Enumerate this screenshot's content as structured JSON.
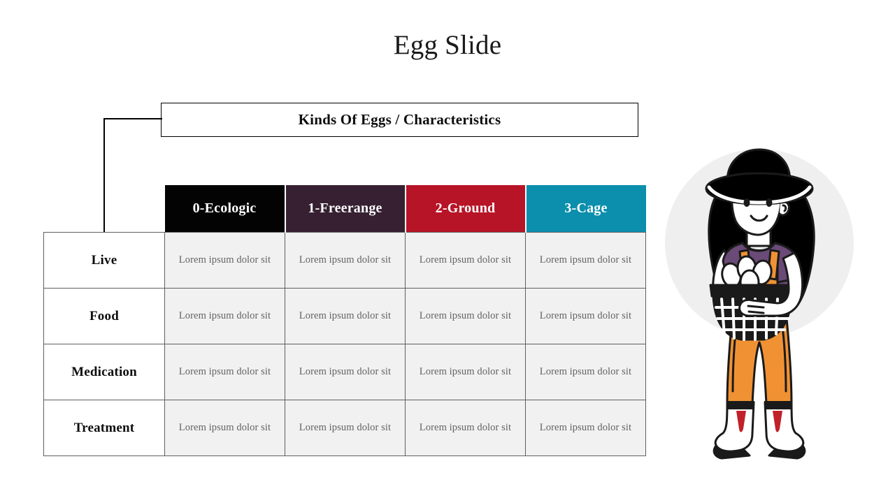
{
  "slide": {
    "title": "Egg Slide",
    "background_color": "#ffffff"
  },
  "banner": {
    "text": "Kinds Of Eggs / Characteristics",
    "border_color": "#000000",
    "background_color": "#ffffff"
  },
  "table": {
    "corner_label": "",
    "columns": [
      {
        "label": "0-Ecologic",
        "color": "#030303"
      },
      {
        "label": "1-Freerange",
        "color": "#362032"
      },
      {
        "label": "2-Ground",
        "color": "#b81427"
      },
      {
        "label": "3-Cage",
        "color": "#0b8fad"
      }
    ],
    "rows": [
      {
        "label": "Live",
        "cells": [
          "Lorem ipsum dolor sit",
          "Lorem ipsum dolor sit",
          "Lorem ipsum dolor sit",
          "Lorem ipsum dolor sit"
        ]
      },
      {
        "label": "Food",
        "cells": [
          "Lorem ipsum dolor sit",
          "Lorem ipsum dolor sit",
          "Lorem ipsum dolor sit",
          "Lorem ipsum dolor sit"
        ]
      },
      {
        "label": "Medication",
        "cells": [
          "Lorem ipsum dolor sit",
          "Lorem ipsum dolor sit",
          "Lorem ipsum dolor sit",
          "Lorem ipsum dolor sit"
        ]
      },
      {
        "label": "Treatment",
        "cells": [
          "Lorem ipsum dolor sit",
          "Lorem ipsum dolor sit",
          "Lorem ipsum dolor sit",
          "Lorem ipsum dolor sit"
        ]
      }
    ],
    "cell_background": "#f1f1f1",
    "label_background": "#ffffff",
    "grid_color": "#5f5f5f",
    "header_text_color": "#ffffff"
  },
  "illustration": {
    "name": "farmer-woman-with-egg-basket",
    "circle_color": "#f0efef",
    "palette": {
      "hat": "#000000",
      "hair": "#000000",
      "skin": "#ffffff",
      "shirt": "#6a4a76",
      "overalls": "#f09233",
      "boots": "#ffffff",
      "boot_accent": "#c1212a",
      "basket": "#1a1a1a",
      "eggs": "#ffffff",
      "outline": "#1a1a1a"
    }
  }
}
